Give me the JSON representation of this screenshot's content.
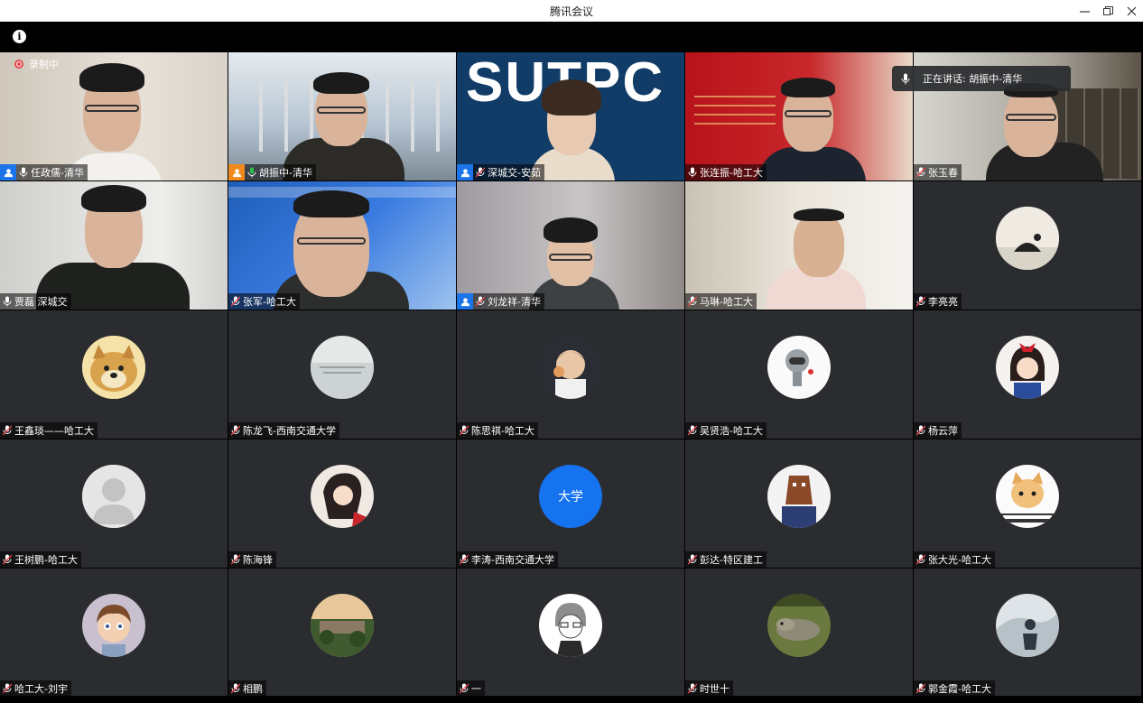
{
  "window": {
    "title": "腾讯会议"
  },
  "toolbar": {
    "info_icon": "i"
  },
  "recording": {
    "label": "录制中"
  },
  "speaking": {
    "label": "正在讲话: 胡振中-清华"
  },
  "colors": {
    "background": "#000000",
    "tile": "#2b2c2f",
    "host": "#1b74e8",
    "cohost": "#f08a1e",
    "avatar_text_bg": "#1673f0"
  },
  "participants": [
    {
      "name": "任政儒-清华",
      "role": "host",
      "mic": "on"
    },
    {
      "name": "胡振中-清华",
      "role": "cohost",
      "mic": "speaking"
    },
    {
      "name": "深城交-安茹",
      "role": "host",
      "mic": "muted"
    },
    {
      "name": "张连振-哈工大",
      "role": "",
      "mic": "on"
    },
    {
      "name": "张玉春",
      "role": "",
      "mic": "muted"
    },
    {
      "name": "贾磊 深城交",
      "role": "",
      "mic": "on"
    },
    {
      "name": "张军-哈工大",
      "role": "",
      "mic": "muted"
    },
    {
      "name": "刘龙祥-清华",
      "role": "host",
      "mic": "muted"
    },
    {
      "name": "马琳-哈工大",
      "role": "",
      "mic": "muted"
    },
    {
      "name": "李亮亮",
      "role": "",
      "mic": "muted"
    },
    {
      "name": "王鑫琰——哈工大",
      "role": "",
      "mic": "muted",
      "avatar": "doge"
    },
    {
      "name": "陈龙飞-西南交通大学",
      "role": "",
      "mic": "muted",
      "avatar": "sky"
    },
    {
      "name": "陈思祺-哈工大",
      "role": "",
      "mic": "muted",
      "avatar": "cartoon"
    },
    {
      "name": "吴贤浩-哈工大",
      "role": "",
      "mic": "muted",
      "avatar": "robot"
    },
    {
      "name": "杨云萍",
      "role": "",
      "mic": "muted",
      "avatar": "girl"
    },
    {
      "name": "王树鹏-哈工大",
      "role": "",
      "mic": "muted",
      "avatar": "default"
    },
    {
      "name": "陈海锋",
      "role": "",
      "mic": "muted",
      "avatar": "anime"
    },
    {
      "name": "李涛-西南交通大学",
      "role": "",
      "mic": "muted",
      "avatar_text": "大学"
    },
    {
      "name": "彭达-特区建工",
      "role": "",
      "mic": "muted",
      "avatar": "horse"
    },
    {
      "name": "张大光-哈工大",
      "role": "",
      "mic": "muted",
      "avatar": "cat"
    },
    {
      "name": "哈工大-刘宇",
      "role": "",
      "mic": "muted",
      "avatar": "boy"
    },
    {
      "name": "相鹏",
      "role": "",
      "mic": "muted",
      "avatar": "building"
    },
    {
      "name": "一",
      "role": "",
      "mic": "muted",
      "avatar": "sketch"
    },
    {
      "name": "时世十",
      "role": "",
      "mic": "muted",
      "avatar": "lizard"
    },
    {
      "name": "郭金霞-哈工大",
      "role": "",
      "mic": "muted",
      "avatar": "outdoor"
    }
  ]
}
